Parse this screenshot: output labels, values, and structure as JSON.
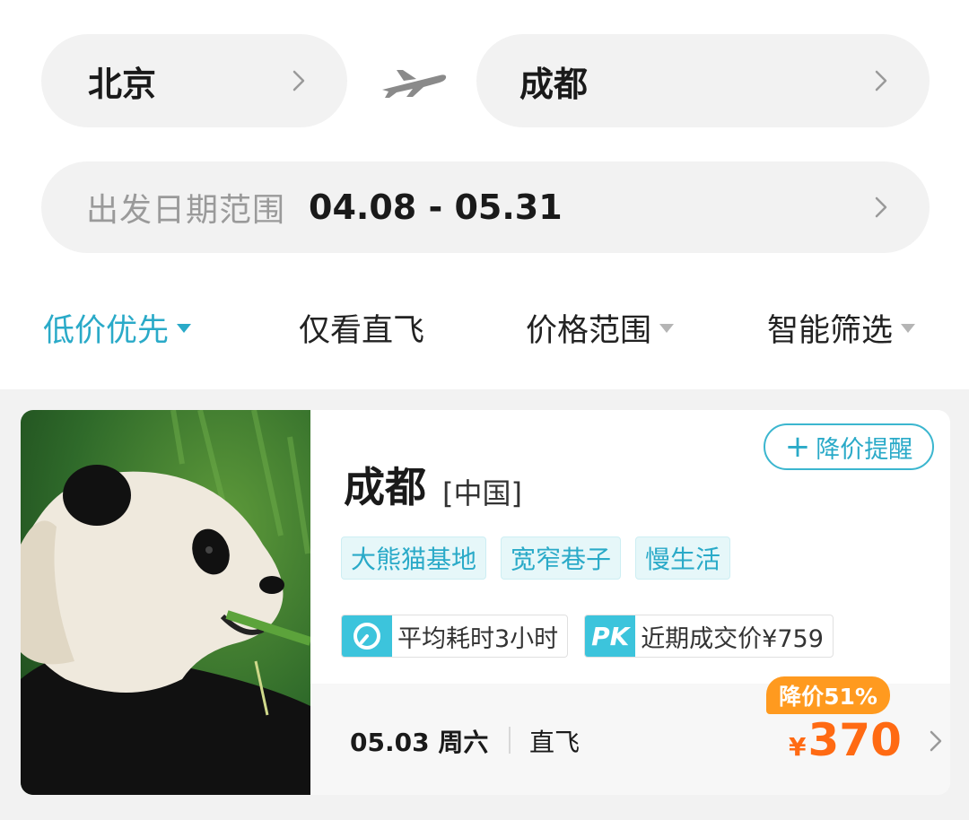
{
  "route": {
    "from_city": "北京",
    "to_city": "成都"
  },
  "date_range": {
    "label": "出发日期范围",
    "value": "04.08 - 05.31"
  },
  "filters": [
    {
      "label": "低价优先",
      "active": true,
      "has_dropdown": true
    },
    {
      "label": "仅看直飞",
      "active": false,
      "has_dropdown": false
    },
    {
      "label": "价格范围",
      "active": false,
      "has_dropdown": true
    },
    {
      "label": "智能筛选",
      "active": false,
      "has_dropdown": true
    }
  ],
  "card": {
    "destination": "成都",
    "country": "[中国]",
    "alert_label": "降价提醒",
    "tags": [
      "大熊猫基地",
      "宽窄巷子",
      "慢生活"
    ],
    "info": {
      "avg_time": "平均耗时3小时",
      "pk_badge": "PK",
      "recent_price": "近期成交价¥759"
    },
    "flight_date": "05.03 周六",
    "flight_type": "直飞",
    "discount": "降价51%",
    "price_symbol": "¥",
    "price": "370"
  },
  "colors": {
    "accent": "#2aaac8",
    "price": "#ff6a13",
    "discount_badge": "#ff9a1f",
    "pill_bg": "#f2f2f2"
  },
  "icons": [
    "chevron-right-icon",
    "plane-icon",
    "dropdown-triangle-icon",
    "plus-icon",
    "clock-icon"
  ]
}
